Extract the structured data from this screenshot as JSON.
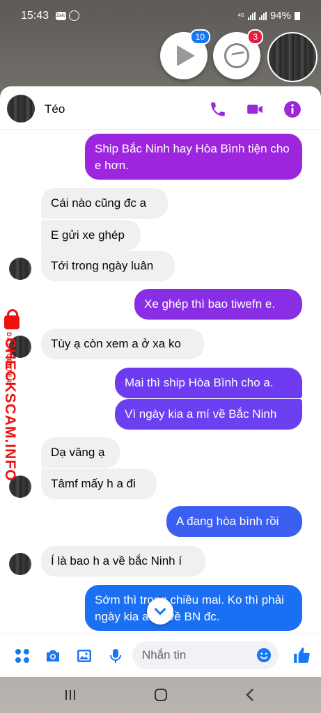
{
  "status_bar": {
    "time": "15:43",
    "zalo_icon_text": "Zalo",
    "network": "4G",
    "battery": "94%"
  },
  "chat_heads": {
    "video_badge": "10",
    "messenger_badge": "3"
  },
  "conversation": {
    "contact_name": "Téo"
  },
  "messages": [
    {
      "dir": "out",
      "text": "Ship Bắc Ninh hay Hòa Bình tiện cho e hơn."
    },
    {
      "dir": "in",
      "text": "Cái nào cũng đc a"
    },
    {
      "dir": "in",
      "text": "E gửi xe ghép"
    },
    {
      "dir": "in",
      "text": "Tới trong ngày luân"
    },
    {
      "dir": "out",
      "text": "Xe ghép thì bao tiwefn e."
    },
    {
      "dir": "in",
      "text": "Tùy ạ còn xem a ở xa ko"
    },
    {
      "dir": "out",
      "text": "Mai thì ship Hòa Bình cho a."
    },
    {
      "dir": "out",
      "text": "Vì ngày kia a mí về Bắc Ninh"
    },
    {
      "dir": "in",
      "text": "Dạ vâng ạ"
    },
    {
      "dir": "in",
      "text": "Tâmf mấy h a đi"
    },
    {
      "dir": "out",
      "text": "A đang hòa bình rồi"
    },
    {
      "dir": "in",
      "text": "Í là bao h a về bắc Ninh í"
    },
    {
      "dir": "out",
      "text": "Sớm thì trong chiều mai. Ko thì phải ngày kia a mí về BN đc."
    }
  ],
  "watermark": {
    "main": "CHECKSCAM.INFO",
    "sub": "DATA CENTER"
  },
  "composer": {
    "placeholder": "Nhắn tin"
  },
  "colors": {
    "messenger_purple": "#9b27d8",
    "out_top": "#9d25de",
    "out_mid": "#6e3bf0",
    "out_bottom": "#1a6ff2",
    "accent_blue": "#1877f2"
  }
}
